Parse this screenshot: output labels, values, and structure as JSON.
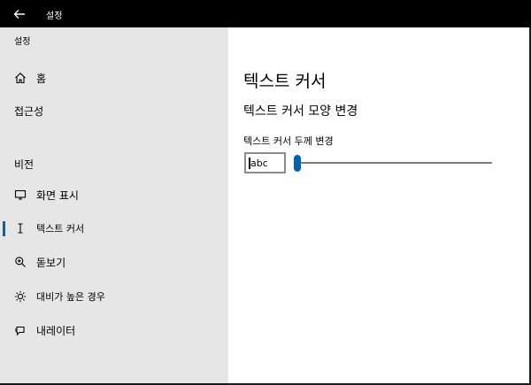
{
  "titlebar": {
    "title": "설정",
    "back_icon": "back-arrow-icon"
  },
  "sidebar": {
    "app_label": "설정",
    "home": {
      "label": "홈",
      "icon": "home-icon"
    },
    "group_label": "접근성",
    "section_label": "비전",
    "items": [
      {
        "label": "화면 표시",
        "icon": "monitor-icon",
        "selected": false
      },
      {
        "label": "텍스트 커서",
        "icon": "text-cursor-icon",
        "selected": true
      },
      {
        "label": "돋보기",
        "icon": "magnifier-icon",
        "selected": false
      },
      {
        "label": "대비가 높은 경우",
        "icon": "contrast-sun-icon",
        "selected": false
      },
      {
        "label": "내레이터",
        "icon": "narrator-icon",
        "selected": false
      }
    ],
    "accent_color": "#0063b1"
  },
  "main": {
    "title": "텍스트 커서",
    "section_title": "텍스트 커서 모양 변경",
    "thickness": {
      "label": "텍스트 커서 두께 변경",
      "preview_text": "abc",
      "value_fraction": 0.0
    }
  },
  "colors": {
    "titlebar_bg": "#000000",
    "sidebar_bg": "#e6e6e6",
    "accent": "#0063b1"
  }
}
